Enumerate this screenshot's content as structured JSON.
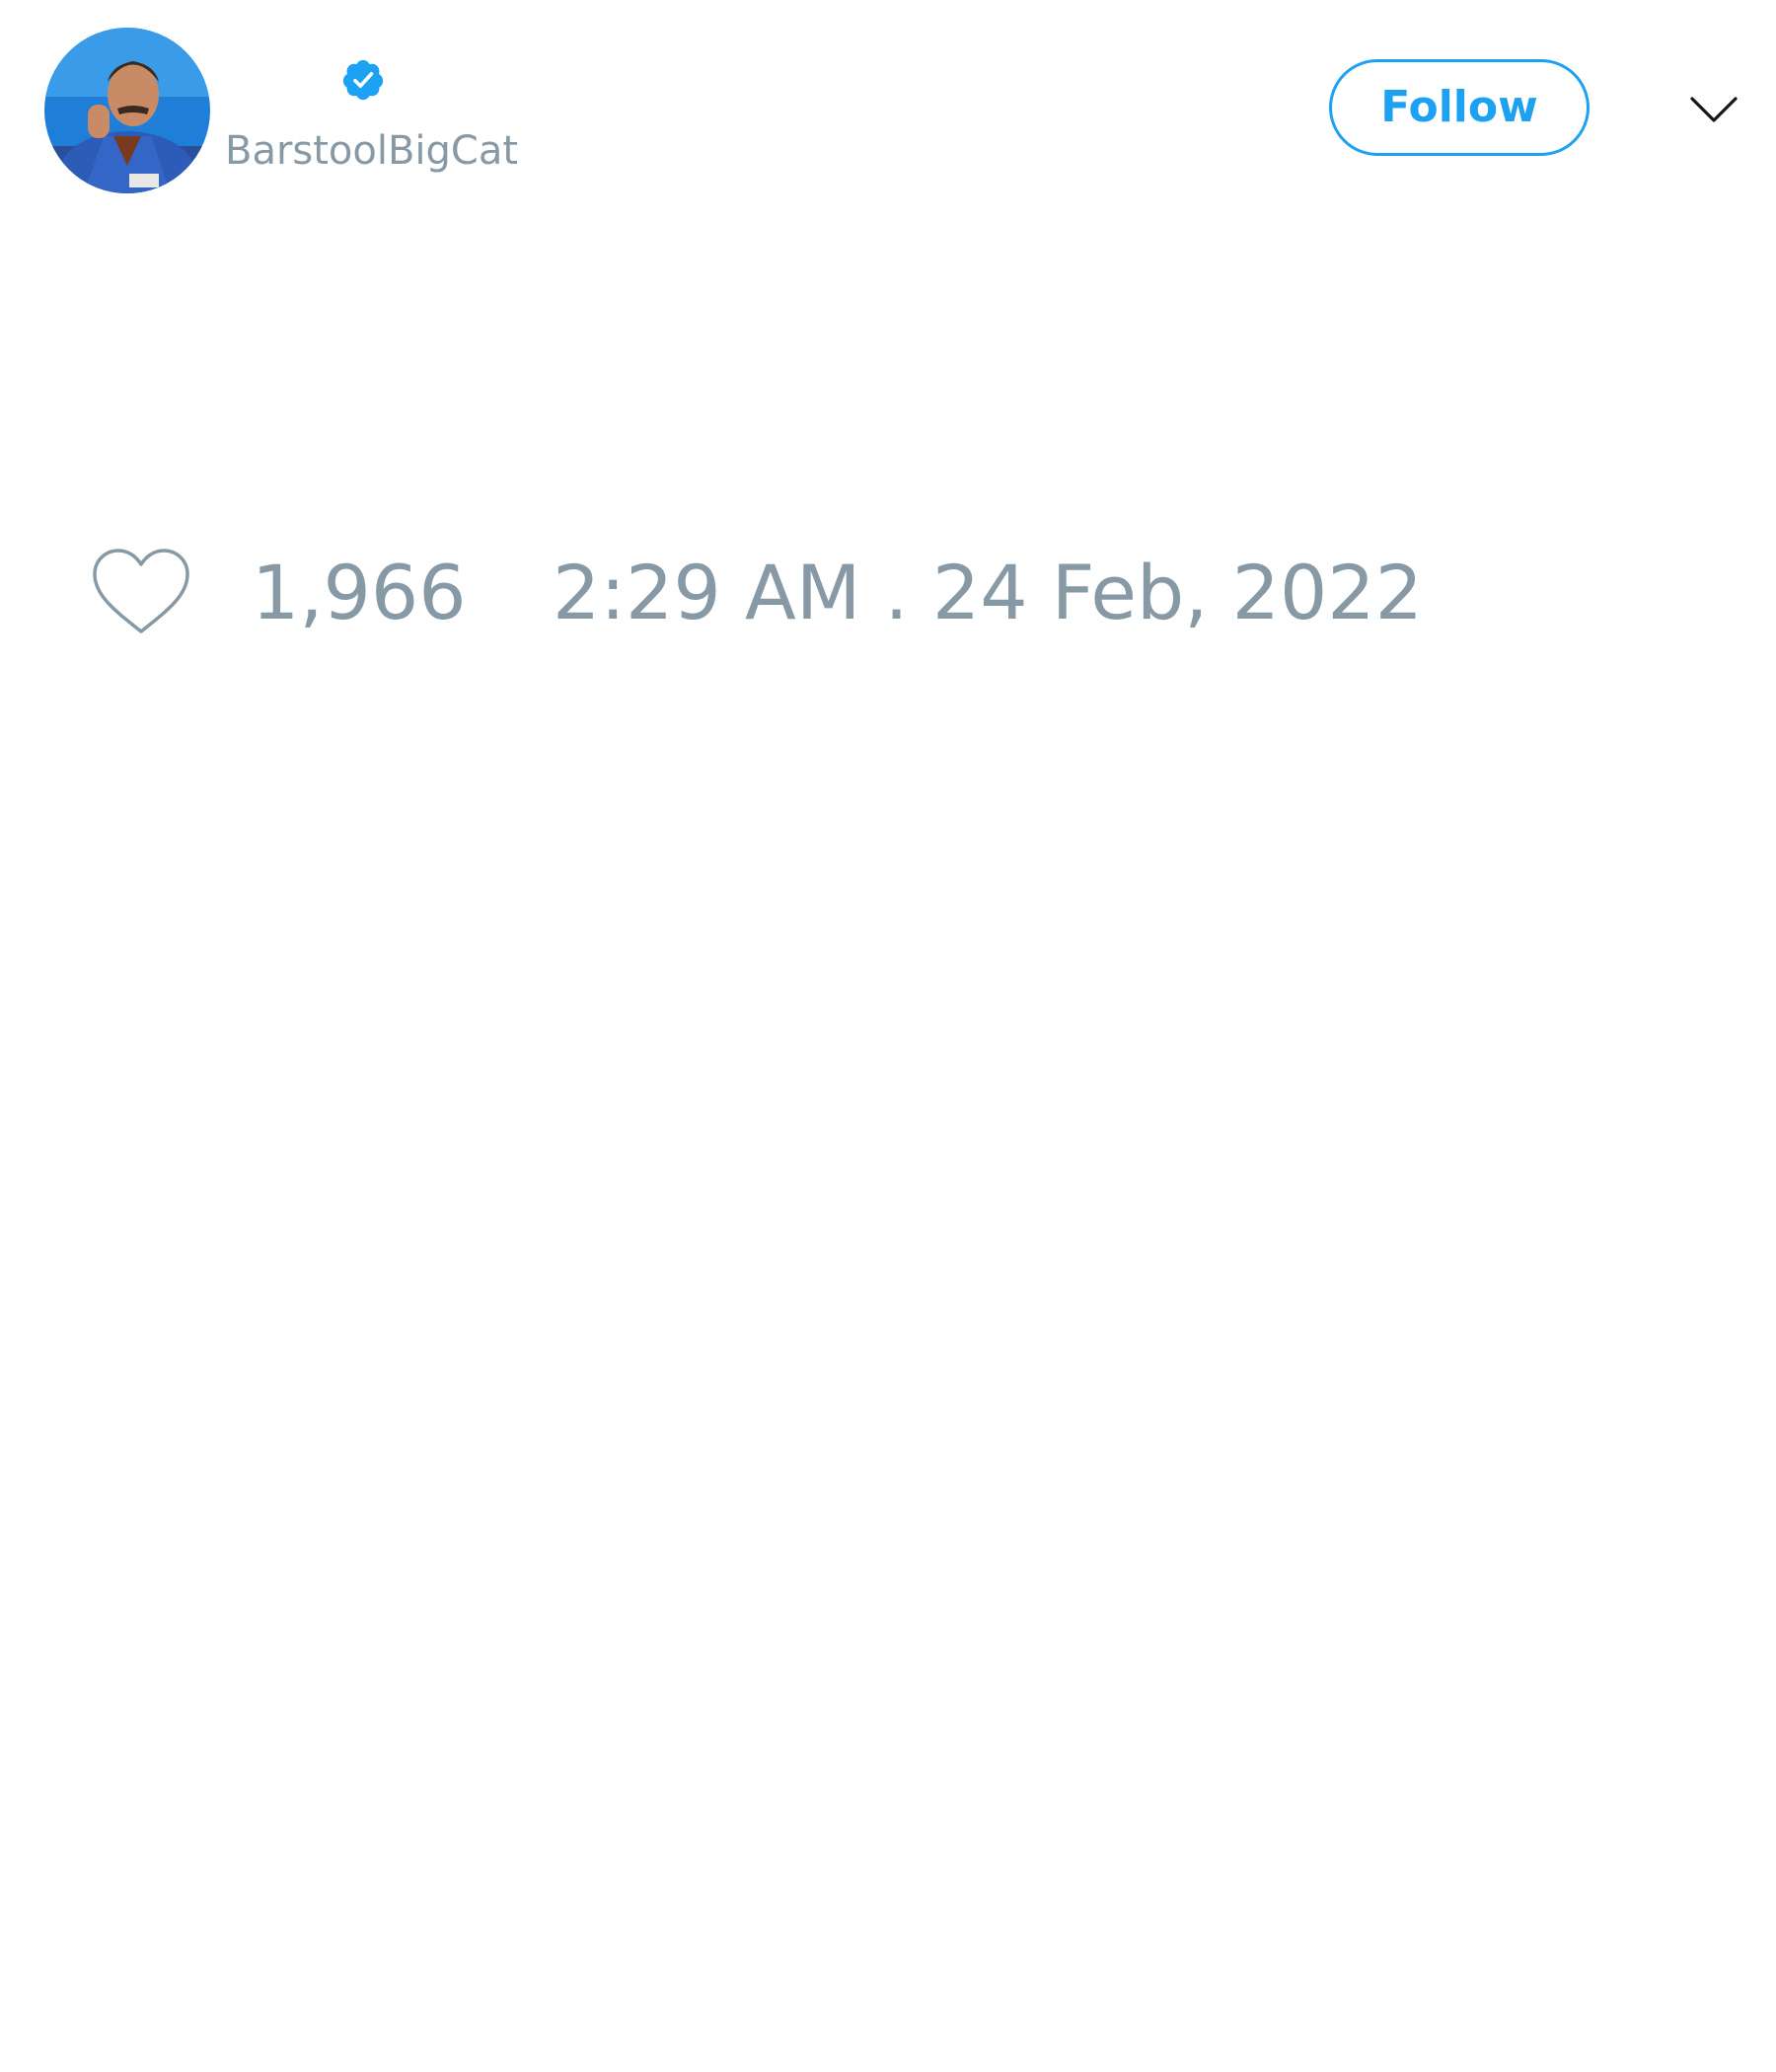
{
  "tweet": {
    "author": {
      "handle": "BarstoolBigCat",
      "verified": true,
      "avatar": "profile-photo"
    },
    "follow_label": "Follow",
    "menu_icon": "chevron-down-icon",
    "likes": {
      "icon": "heart-icon",
      "count": "1,966"
    },
    "timestamp": "2:29 AM . 24 Feb, 2022"
  },
  "colors": {
    "accent": "#1da1f2",
    "muted_text": "#8899a6",
    "icon_stroke": "#8899a6",
    "chevron": "#14171a",
    "background": "#ffffff"
  }
}
